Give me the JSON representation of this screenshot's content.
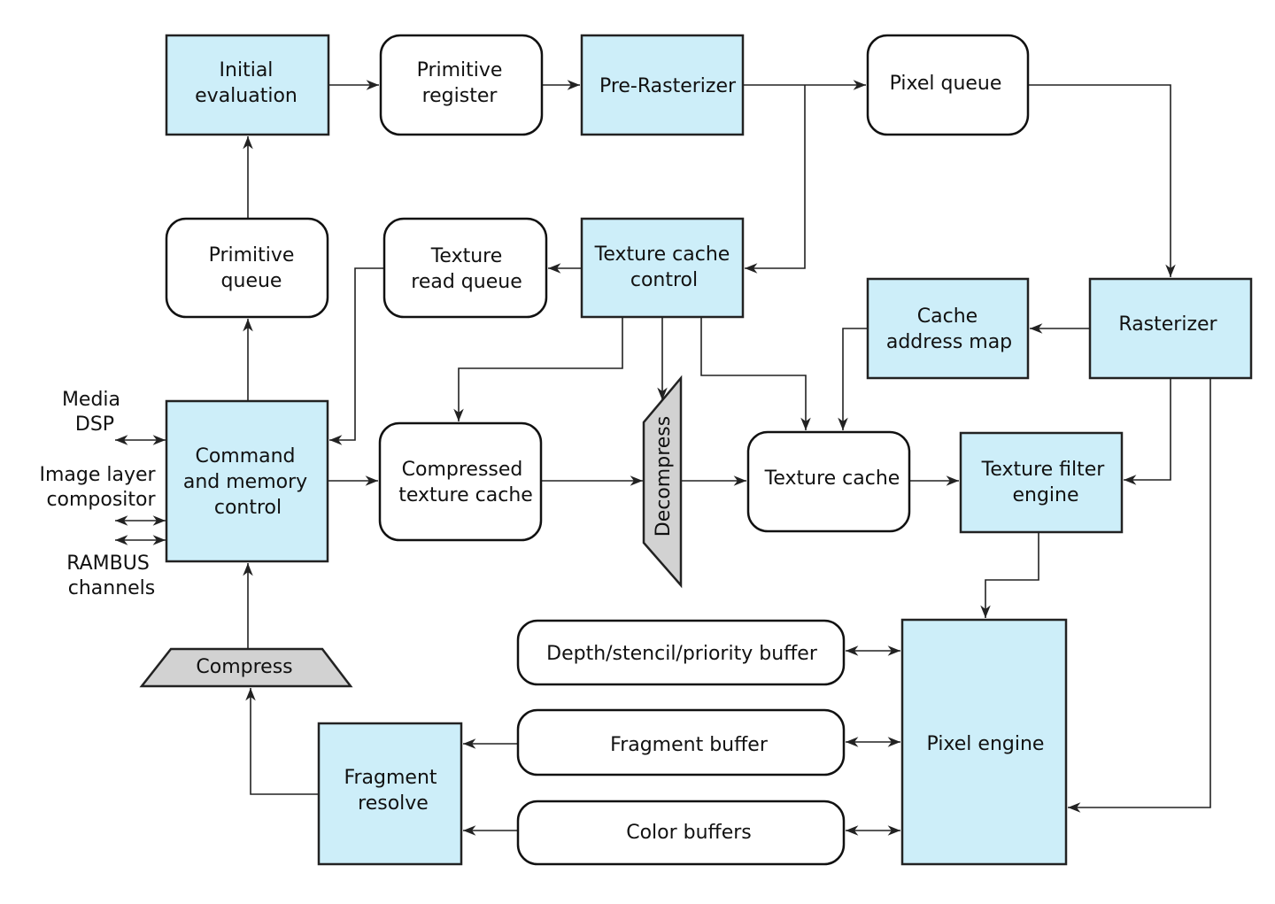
{
  "colors": {
    "processing_block": "#cdeef9",
    "storage_block": "#ffffff",
    "codec_block": "#d2d2d2",
    "line": "#222222"
  },
  "blocks": {
    "initial_evaluation": [
      "Initial",
      "evaluation"
    ],
    "primitive_register": [
      "Primitive",
      "register"
    ],
    "pre_rasterizer": "Pre-Rasterizer",
    "pixel_queue": "Pixel queue",
    "primitive_queue": [
      "Primitive",
      "queue"
    ],
    "texture_read_queue": [
      "Texture",
      "read queue"
    ],
    "texture_cache_control": [
      "Texture cache",
      "control"
    ],
    "cache_address_map": [
      "Cache",
      "address map"
    ],
    "rasterizer": "Rasterizer",
    "command_memory_control": [
      "Command",
      "and memory",
      "control"
    ],
    "compressed_texture_cache": [
      "Compressed",
      "texture cache"
    ],
    "decompress": "Decompress",
    "texture_cache": "Texture cache",
    "texture_filter_engine": [
      "Texture filter",
      "engine"
    ],
    "depth_buffer": "Depth/stencil/priority buffer",
    "fragment_buffer": "Fragment buffer",
    "color_buffers": "Color buffers",
    "pixel_engine": "Pixel engine",
    "fragment_resolve": [
      "Fragment",
      "resolve"
    ],
    "compress": "Compress"
  },
  "external": {
    "media_dsp": [
      "Media",
      "DSP"
    ],
    "image_layer_compositor": [
      "Image layer",
      "compositor"
    ],
    "rambus_channels": [
      "RAMBUS",
      "channels"
    ]
  }
}
